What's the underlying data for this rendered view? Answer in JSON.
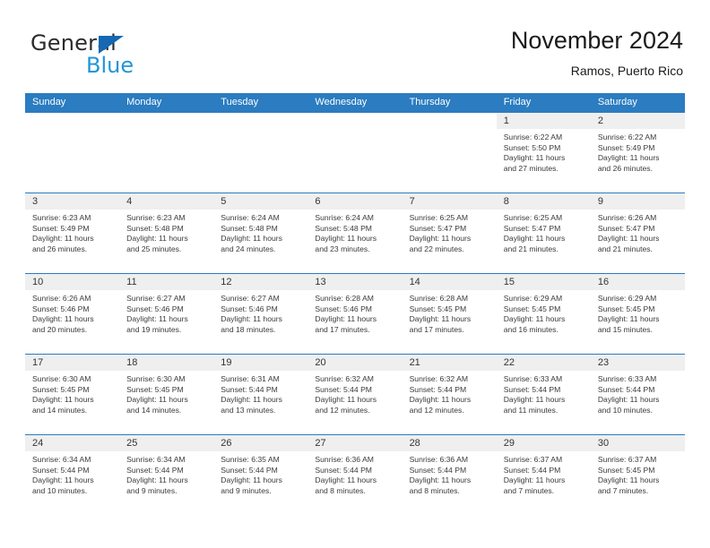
{
  "brand": {
    "name_top": "General",
    "name_bottom": "Blue",
    "triangle_color": "#1668b3",
    "blue_text_color": "#2196d6"
  },
  "header": {
    "month_title": "November 2024",
    "location": "Ramos, Puerto Rico"
  },
  "calendar": {
    "header_bg": "#2b7cc0",
    "cell_band_bg": "#efeff0",
    "weekdays": [
      "Sunday",
      "Monday",
      "Tuesday",
      "Wednesday",
      "Thursday",
      "Friday",
      "Saturday"
    ],
    "weeks": [
      [
        {
          "day": "",
          "sunrise": "",
          "sunset": "",
          "daylight_line1": "",
          "daylight_line2": ""
        },
        {
          "day": "",
          "sunrise": "",
          "sunset": "",
          "daylight_line1": "",
          "daylight_line2": ""
        },
        {
          "day": "",
          "sunrise": "",
          "sunset": "",
          "daylight_line1": "",
          "daylight_line2": ""
        },
        {
          "day": "",
          "sunrise": "",
          "sunset": "",
          "daylight_line1": "",
          "daylight_line2": ""
        },
        {
          "day": "",
          "sunrise": "",
          "sunset": "",
          "daylight_line1": "",
          "daylight_line2": ""
        },
        {
          "day": "1",
          "sunrise": "Sunrise: 6:22 AM",
          "sunset": "Sunset: 5:50 PM",
          "daylight_line1": "Daylight: 11 hours",
          "daylight_line2": "and 27 minutes."
        },
        {
          "day": "2",
          "sunrise": "Sunrise: 6:22 AM",
          "sunset": "Sunset: 5:49 PM",
          "daylight_line1": "Daylight: 11 hours",
          "daylight_line2": "and 26 minutes."
        }
      ],
      [
        {
          "day": "3",
          "sunrise": "Sunrise: 6:23 AM",
          "sunset": "Sunset: 5:49 PM",
          "daylight_line1": "Daylight: 11 hours",
          "daylight_line2": "and 26 minutes."
        },
        {
          "day": "4",
          "sunrise": "Sunrise: 6:23 AM",
          "sunset": "Sunset: 5:48 PM",
          "daylight_line1": "Daylight: 11 hours",
          "daylight_line2": "and 25 minutes."
        },
        {
          "day": "5",
          "sunrise": "Sunrise: 6:24 AM",
          "sunset": "Sunset: 5:48 PM",
          "daylight_line1": "Daylight: 11 hours",
          "daylight_line2": "and 24 minutes."
        },
        {
          "day": "6",
          "sunrise": "Sunrise: 6:24 AM",
          "sunset": "Sunset: 5:48 PM",
          "daylight_line1": "Daylight: 11 hours",
          "daylight_line2": "and 23 minutes."
        },
        {
          "day": "7",
          "sunrise": "Sunrise: 6:25 AM",
          "sunset": "Sunset: 5:47 PM",
          "daylight_line1": "Daylight: 11 hours",
          "daylight_line2": "and 22 minutes."
        },
        {
          "day": "8",
          "sunrise": "Sunrise: 6:25 AM",
          "sunset": "Sunset: 5:47 PM",
          "daylight_line1": "Daylight: 11 hours",
          "daylight_line2": "and 21 minutes."
        },
        {
          "day": "9",
          "sunrise": "Sunrise: 6:26 AM",
          "sunset": "Sunset: 5:47 PM",
          "daylight_line1": "Daylight: 11 hours",
          "daylight_line2": "and 21 minutes."
        }
      ],
      [
        {
          "day": "10",
          "sunrise": "Sunrise: 6:26 AM",
          "sunset": "Sunset: 5:46 PM",
          "daylight_line1": "Daylight: 11 hours",
          "daylight_line2": "and 20 minutes."
        },
        {
          "day": "11",
          "sunrise": "Sunrise: 6:27 AM",
          "sunset": "Sunset: 5:46 PM",
          "daylight_line1": "Daylight: 11 hours",
          "daylight_line2": "and 19 minutes."
        },
        {
          "day": "12",
          "sunrise": "Sunrise: 6:27 AM",
          "sunset": "Sunset: 5:46 PM",
          "daylight_line1": "Daylight: 11 hours",
          "daylight_line2": "and 18 minutes."
        },
        {
          "day": "13",
          "sunrise": "Sunrise: 6:28 AM",
          "sunset": "Sunset: 5:46 PM",
          "daylight_line1": "Daylight: 11 hours",
          "daylight_line2": "and 17 minutes."
        },
        {
          "day": "14",
          "sunrise": "Sunrise: 6:28 AM",
          "sunset": "Sunset: 5:45 PM",
          "daylight_line1": "Daylight: 11 hours",
          "daylight_line2": "and 17 minutes."
        },
        {
          "day": "15",
          "sunrise": "Sunrise: 6:29 AM",
          "sunset": "Sunset: 5:45 PM",
          "daylight_line1": "Daylight: 11 hours",
          "daylight_line2": "and 16 minutes."
        },
        {
          "day": "16",
          "sunrise": "Sunrise: 6:29 AM",
          "sunset": "Sunset: 5:45 PM",
          "daylight_line1": "Daylight: 11 hours",
          "daylight_line2": "and 15 minutes."
        }
      ],
      [
        {
          "day": "17",
          "sunrise": "Sunrise: 6:30 AM",
          "sunset": "Sunset: 5:45 PM",
          "daylight_line1": "Daylight: 11 hours",
          "daylight_line2": "and 14 minutes."
        },
        {
          "day": "18",
          "sunrise": "Sunrise: 6:30 AM",
          "sunset": "Sunset: 5:45 PM",
          "daylight_line1": "Daylight: 11 hours",
          "daylight_line2": "and 14 minutes."
        },
        {
          "day": "19",
          "sunrise": "Sunrise: 6:31 AM",
          "sunset": "Sunset: 5:44 PM",
          "daylight_line1": "Daylight: 11 hours",
          "daylight_line2": "and 13 minutes."
        },
        {
          "day": "20",
          "sunrise": "Sunrise: 6:32 AM",
          "sunset": "Sunset: 5:44 PM",
          "daylight_line1": "Daylight: 11 hours",
          "daylight_line2": "and 12 minutes."
        },
        {
          "day": "21",
          "sunrise": "Sunrise: 6:32 AM",
          "sunset": "Sunset: 5:44 PM",
          "daylight_line1": "Daylight: 11 hours",
          "daylight_line2": "and 12 minutes."
        },
        {
          "day": "22",
          "sunrise": "Sunrise: 6:33 AM",
          "sunset": "Sunset: 5:44 PM",
          "daylight_line1": "Daylight: 11 hours",
          "daylight_line2": "and 11 minutes."
        },
        {
          "day": "23",
          "sunrise": "Sunrise: 6:33 AM",
          "sunset": "Sunset: 5:44 PM",
          "daylight_line1": "Daylight: 11 hours",
          "daylight_line2": "and 10 minutes."
        }
      ],
      [
        {
          "day": "24",
          "sunrise": "Sunrise: 6:34 AM",
          "sunset": "Sunset: 5:44 PM",
          "daylight_line1": "Daylight: 11 hours",
          "daylight_line2": "and 10 minutes."
        },
        {
          "day": "25",
          "sunrise": "Sunrise: 6:34 AM",
          "sunset": "Sunset: 5:44 PM",
          "daylight_line1": "Daylight: 11 hours",
          "daylight_line2": "and 9 minutes."
        },
        {
          "day": "26",
          "sunrise": "Sunrise: 6:35 AM",
          "sunset": "Sunset: 5:44 PM",
          "daylight_line1": "Daylight: 11 hours",
          "daylight_line2": "and 9 minutes."
        },
        {
          "day": "27",
          "sunrise": "Sunrise: 6:36 AM",
          "sunset": "Sunset: 5:44 PM",
          "daylight_line1": "Daylight: 11 hours",
          "daylight_line2": "and 8 minutes."
        },
        {
          "day": "28",
          "sunrise": "Sunrise: 6:36 AM",
          "sunset": "Sunset: 5:44 PM",
          "daylight_line1": "Daylight: 11 hours",
          "daylight_line2": "and 8 minutes."
        },
        {
          "day": "29",
          "sunrise": "Sunrise: 6:37 AM",
          "sunset": "Sunset: 5:44 PM",
          "daylight_line1": "Daylight: 11 hours",
          "daylight_line2": "and 7 minutes."
        },
        {
          "day": "30",
          "sunrise": "Sunrise: 6:37 AM",
          "sunset": "Sunset: 5:45 PM",
          "daylight_line1": "Daylight: 11 hours",
          "daylight_line2": "and 7 minutes."
        }
      ]
    ]
  }
}
